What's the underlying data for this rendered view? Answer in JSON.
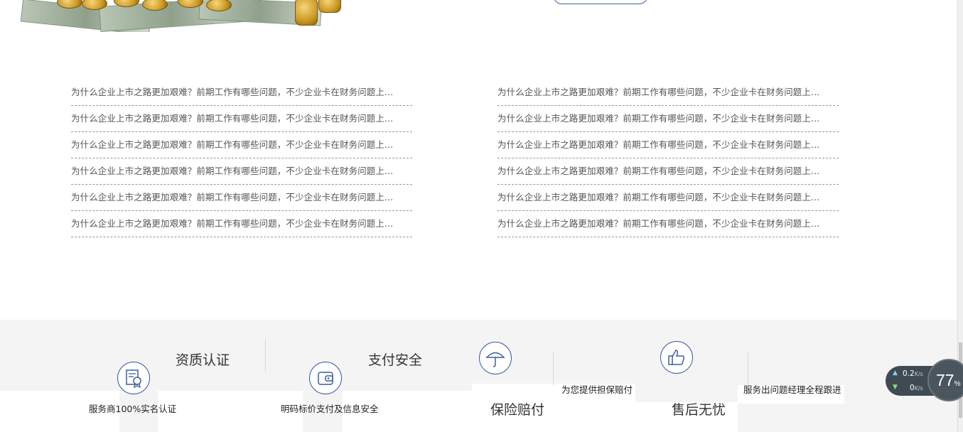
{
  "news": {
    "left": [
      "为什么企业上市之路更加艰难？前期工作有哪些问题，不少企业卡在财务问题上...",
      "为什么企业上市之路更加艰难？前期工作有哪些问题，不少企业卡在财务问题上...",
      "为什么企业上市之路更加艰难？前期工作有哪些问题，不少企业卡在财务问题上...",
      "为什么企业上市之路更加艰难？前期工作有哪些问题，不少企业卡在财务问题上...",
      "为什么企业上市之路更加艰难？前期工作有哪些问题，不少企业卡在财务问题上...",
      "为什么企业上市之路更加艰难？前期工作有哪些问题，不少企业卡在财务问题上..."
    ],
    "right": [
      "为什么企业上市之路更加艰难？前期工作有哪些问题，不少企业卡在财务问题上...",
      "为什么企业上市之路更加艰难？前期工作有哪些问题，不少企业卡在财务问题上...",
      "为什么企业上市之路更加艰难？前期工作有哪些问题，不少企业卡在财务问题上...",
      "为什么企业上市之路更加艰难？前期工作有哪些问题，不少企业卡在财务问题上...",
      "为什么企业上市之路更加艰难？前期工作有哪些问题，不少企业卡在财务问题上...",
      "为什么企业上市之路更加艰难？前期工作有哪些问题，不少企业卡在财务问题上..."
    ]
  },
  "features": {
    "qualification": {
      "title": "资质认证",
      "desc": "服务商100%实名认证",
      "icon": "certificate-icon"
    },
    "payment": {
      "title": "支付安全",
      "desc": "明码标价支付及信息安全",
      "icon": "wallet-icon"
    },
    "insurance": {
      "title": "保险赔付",
      "desc": "为您提供担保赔付",
      "icon": "umbrella-icon"
    },
    "aftersales": {
      "title": "售后无忧",
      "desc": "服务出问题经理全程跟进",
      "icon": "thumbs-up-icon"
    }
  },
  "widget": {
    "upload": "0.2",
    "upload_unit": "K/s",
    "download": "0",
    "download_unit": "K/s",
    "percent": "77",
    "percent_sign": "%"
  },
  "colors": {
    "accent": "#3a5fa0",
    "footer_bg": "#f4f4f4",
    "text": "#555555"
  }
}
